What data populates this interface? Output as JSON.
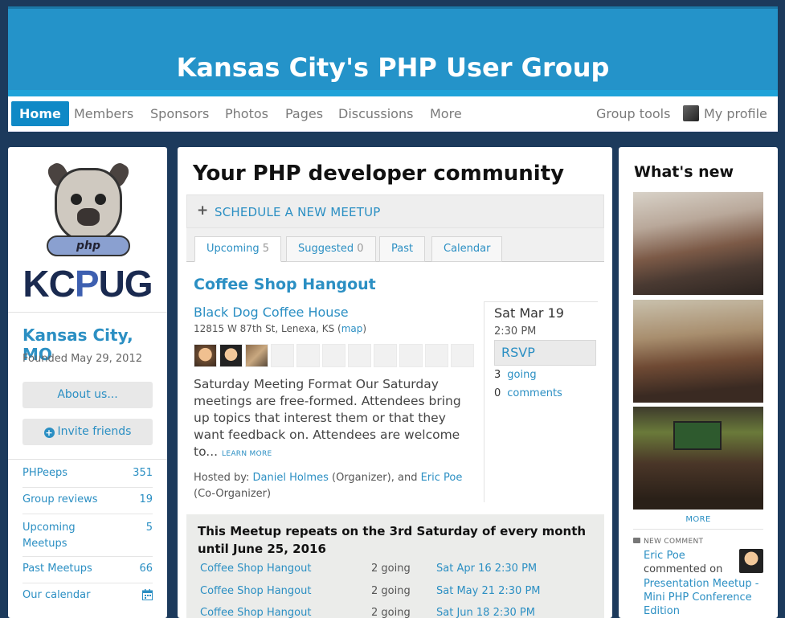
{
  "banner": {
    "title": "Kansas City's PHP User Group"
  },
  "nav": {
    "items": [
      "Home",
      "Members",
      "Sponsors",
      "Photos",
      "Pages",
      "Discussions",
      "More"
    ],
    "group_tools": "Group tools",
    "my_profile": "My profile"
  },
  "sidebar": {
    "logo_text": "KCPUG",
    "logo_collar": "php",
    "city": "Kansas City, MO",
    "founded": "Founded May 29, 2012",
    "about_label": "About us...",
    "invite_label": "Invite friends",
    "stats": [
      {
        "label": "PHPeeps",
        "count": "351"
      },
      {
        "label": "Group reviews",
        "count": "19"
      },
      {
        "label": "Upcoming Meetups",
        "count": "5"
      },
      {
        "label": "Past Meetups",
        "count": "66"
      },
      {
        "label": "Our calendar",
        "count": ""
      }
    ]
  },
  "main": {
    "heading": "Your PHP developer community",
    "schedule_label": "SCHEDULE A NEW MEETUP",
    "tabs": [
      {
        "label": "Upcoming",
        "count": "5"
      },
      {
        "label": "Suggested",
        "count": "0"
      },
      {
        "label": "Past",
        "count": ""
      },
      {
        "label": "Calendar",
        "count": ""
      }
    ],
    "event": {
      "title": "Coffee Shop Hangout",
      "venue": "Black Dog Coffee House",
      "address": "12815 W 87th St, Lenexa, KS (",
      "map_label": "map",
      "address_end": ")",
      "description": "Saturday Meeting Format Our Saturday meetings are free-formed. Attendees bring up topics that interest them or that they want feedback on. Attendees are welcome to...",
      "learn_more": "LEARN MORE",
      "hosted_prefix": "Hosted by: ",
      "host1": "Daniel Holmes",
      "host1_role": " (Organizer), and ",
      "host2": "Eric Poe",
      "host2_role": " (Co-Organizer)",
      "date": "Sat Mar 19",
      "time": "2:30 PM",
      "rsvp": "RSVP",
      "going_count": "3",
      "going_label": "going",
      "comments_count": "0",
      "comments_label": "comments"
    },
    "repeat": {
      "heading": "This Meetup repeats on the 3rd Saturday of every month until June 25, 2016",
      "rows": [
        {
          "name": "Coffee Shop Hangout",
          "going": "2 going",
          "when": "Sat Apr 16 2:30 PM"
        },
        {
          "name": "Coffee Shop Hangout",
          "going": "2 going",
          "when": "Sat May 21 2:30 PM"
        },
        {
          "name": "Coffee Shop Hangout",
          "going": "2 going",
          "when": "Sat Jun 18 2:30 PM"
        }
      ]
    }
  },
  "whats_new": {
    "heading": "What's new",
    "more_label": "MORE",
    "new_comment_tag": "NEW COMMENT",
    "commenter": "Eric Poe",
    "verb": "commented on",
    "target": "Presentation Meetup - Mini PHP Conference Edition"
  }
}
